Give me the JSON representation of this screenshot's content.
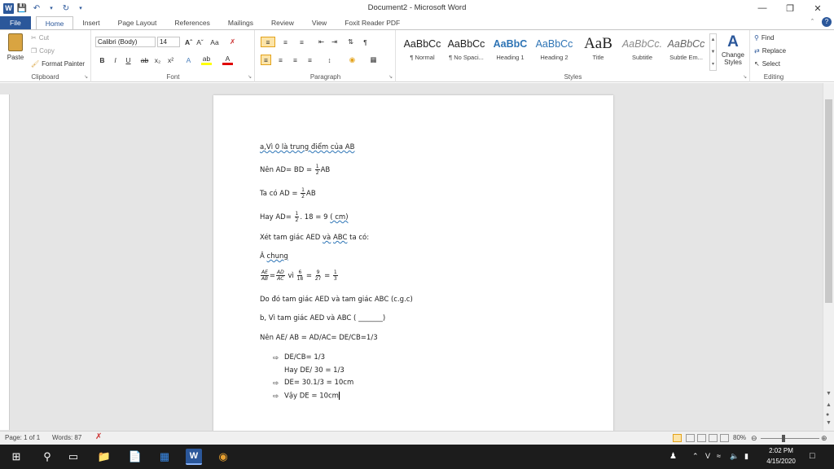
{
  "window": {
    "title": "Document2 - Microsoft Word"
  },
  "tabs": [
    "File",
    "Home",
    "Insert",
    "Page Layout",
    "References",
    "Mailings",
    "Review",
    "View",
    "Foxit Reader PDF"
  ],
  "clipboard": {
    "paste": "Paste",
    "cut": "Cut",
    "copy": "Copy",
    "format_painter": "Format Painter",
    "label": "Clipboard"
  },
  "font": {
    "name": "Calibri (Body)",
    "size": "14",
    "label": "Font"
  },
  "paragraph": {
    "label": "Paragraph"
  },
  "styles": {
    "label": "Styles",
    "items": [
      {
        "sample": "AaBbCc",
        "name": "¶ Normal"
      },
      {
        "sample": "AaBbCc",
        "name": "¶ No Spaci..."
      },
      {
        "sample": "AaBbC",
        "name": "Heading 1"
      },
      {
        "sample": "AaBbCc",
        "name": "Heading 2"
      },
      {
        "sample": "AaB",
        "name": "Title"
      },
      {
        "sample": "AaBbCc.",
        "name": "Subtitle"
      },
      {
        "sample": "AaBbCc",
        "name": "Subtle Em..."
      }
    ],
    "change_line1": "Change",
    "change_line2": "Styles"
  },
  "editing": {
    "find": "Find",
    "replace": "Replace",
    "select": "Select",
    "label": "Editing"
  },
  "document": {
    "l1": "a,Vì 0 là trung điểm của AB",
    "l2a": "Nên AD= BD = ",
    "l2b": "AB",
    "l3a": "Ta có AD = ",
    "l3b": "AB",
    "l4a": "Hay AD= ",
    "l4b": ". 18 = 9 ",
    "l4c": "( cm)",
    "l5a": "Xét tam giác AED ",
    "l5b": "và",
    "l5c": "ABC",
    "l5d": " ta có:",
    "l6a": "Â ",
    "l6b": "chung",
    "l7a": "AE",
    "l7b": "AB",
    "l7c": "=",
    "l7d": "AD",
    "l7e": "AC",
    "l7f": " vì ",
    "l7g": "6",
    "l7h": "18",
    "l7i": " = ",
    "l7j": "9",
    "l7k": "27",
    "l7l": " = ",
    "l7m": "1",
    "l7n": "3",
    "frac_num": "1",
    "frac_den": "2",
    "l8": "Do đó tam giác AED và tam giác ABC (c.g.c)",
    "l9": "b, Vì tam giác AED và ABC ( _______)",
    "l10": "Nên AE/ AB = AD/AC= DE/CB=1/3",
    "l11": "DE/CB= 1/3",
    "l12": "Hay DE/ 30  = 1/3",
    "l13": "DE= 30.1/3  = 10cm",
    "l14": "Vậy DE = 10cm"
  },
  "status": {
    "page": "Page: 1 of 1",
    "words": "Words: 87",
    "zoom": "80%"
  },
  "taskbar": {
    "time": "2:02 PM",
    "date": "4/15/2020"
  },
  "colors": {
    "accent": "#2b579a",
    "taskbar": "#1c1c1c"
  }
}
